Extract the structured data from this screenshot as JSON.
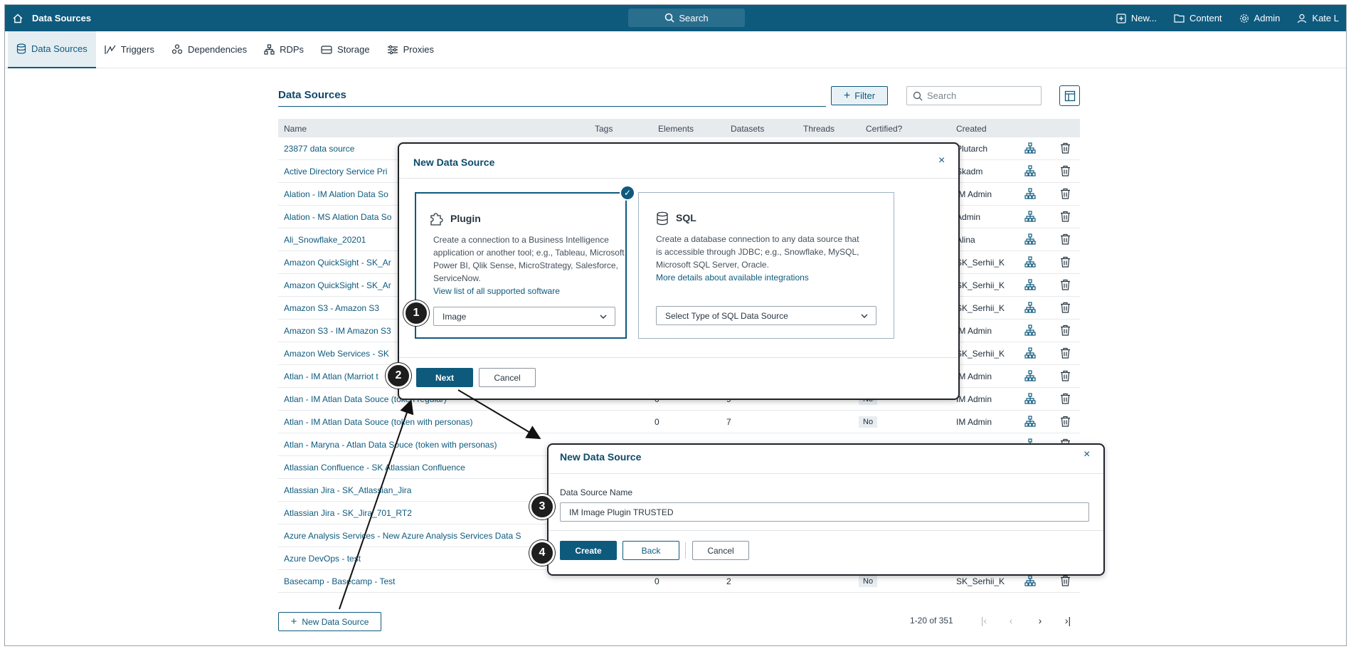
{
  "topbar": {
    "app_title": "Data Sources",
    "search_label": "Search",
    "new_label": "New...",
    "content_label": "Content",
    "admin_label": "Admin",
    "user_label": "Kate L"
  },
  "tabs": [
    {
      "label": "Data Sources",
      "icon": "database-icon"
    },
    {
      "label": "Triggers",
      "icon": "trigger-icon"
    },
    {
      "label": "Dependencies",
      "icon": "dependencies-icon"
    },
    {
      "label": "RDPs",
      "icon": "rdp-icon"
    },
    {
      "label": "Storage",
      "icon": "storage-icon"
    },
    {
      "label": "Proxies",
      "icon": "proxies-icon"
    }
  ],
  "main": {
    "title": "Data Sources",
    "filter_label": "Filter",
    "search_placeholder": "Search",
    "columns": {
      "name": "Name",
      "tags": "Tags",
      "elements": "Elements",
      "datasets": "Datasets",
      "threads": "Threads",
      "certified": "Certified?",
      "created": "Created"
    },
    "rows": [
      {
        "name": "23877 data source",
        "elements": "",
        "datasets": "",
        "certified": "",
        "created": "Plutarch"
      },
      {
        "name": "Active Directory Service Pri",
        "elements": "",
        "datasets": "",
        "certified": "",
        "created": "Skadm"
      },
      {
        "name": "Alation - IM Alation Data So",
        "elements": "",
        "datasets": "",
        "certified": "",
        "created": "IM Admin"
      },
      {
        "name": "Alation - MS Alation Data So",
        "elements": "",
        "datasets": "",
        "certified": "",
        "created": "Admin"
      },
      {
        "name": "Ali_Snowflake_20201",
        "elements": "",
        "datasets": "",
        "certified": "",
        "created": "Alina"
      },
      {
        "name": "Amazon QuickSight - SK_Ar",
        "elements": "",
        "datasets": "",
        "certified": "",
        "created": "SK_Serhii_K"
      },
      {
        "name": "Amazon QuickSight - SK_Ar",
        "elements": "",
        "datasets": "",
        "certified": "",
        "created": "SK_Serhii_K"
      },
      {
        "name": "Amazon S3 - Amazon S3",
        "elements": "",
        "datasets": "",
        "certified": "",
        "created": "SK_Serhii_K"
      },
      {
        "name": "Amazon S3 - IM Amazon S3",
        "elements": "",
        "datasets": "",
        "certified": "",
        "created": "IM Admin"
      },
      {
        "name": "Amazon Web Services - SK",
        "elements": "",
        "datasets": "",
        "certified": "",
        "created": "SK_Serhii_K"
      },
      {
        "name": "Atlan - IM Atlan (Marriot t",
        "elements": "",
        "datasets": "",
        "certified": "",
        "created": "IM Admin"
      },
      {
        "name": "Atlan - IM Atlan Data Souce (token regular)",
        "elements": "0",
        "datasets": "9",
        "certified": "No",
        "created": "IM Admin"
      },
      {
        "name": "Atlan - IM Atlan Data Souce (token with personas)",
        "elements": "0",
        "datasets": "7",
        "certified": "No",
        "created": "IM Admin"
      },
      {
        "name": "Atlan - Maryna - Atlan Data Souce (token with personas)",
        "elements": "",
        "datasets": "",
        "certified": "",
        "created": ""
      },
      {
        "name": "Atlassian Confluence - SK Atlassian Confluence",
        "elements": "",
        "datasets": "",
        "certified": "",
        "created": ""
      },
      {
        "name": "Atlassian Jira - SK_Atlassian_Jira",
        "elements": "",
        "datasets": "",
        "certified": "",
        "created": ""
      },
      {
        "name": "Atlassian Jira - SK_Jira_701_RT2",
        "elements": "",
        "datasets": "",
        "certified": "",
        "created": ""
      },
      {
        "name": "Azure Analysis Services - New Azure Analysis Services Data S",
        "elements": "",
        "datasets": "",
        "certified": "",
        "created": ""
      },
      {
        "name": "Azure DevOps - test",
        "elements": "",
        "datasets": "",
        "certified": "",
        "created": ""
      },
      {
        "name": "Basecamp - Basecamp - Test",
        "elements": "0",
        "datasets": "2",
        "certified": "No",
        "created": "SK_Serhii_K"
      }
    ],
    "new_button": "New Data Source",
    "pager_text": "1-20 of 351"
  },
  "dialog1": {
    "title": "New Data Source",
    "plugin": {
      "title": "Plugin",
      "desc_lines": [
        "Create a connection to a Business Intelligence",
        "application or another tool; e.g., Tableau, Microsoft",
        "Power BI, Qlik Sense, MicroStrategy, Salesforce,",
        "ServiceNow."
      ],
      "link": "View list of all supported software",
      "select_value": "Image"
    },
    "sql": {
      "title": "SQL",
      "desc_lines": [
        "Create a database connection to any data source that",
        "is accessible through JDBC; e.g., Snowflake, MySQL,",
        "Microsoft SQL Server, Oracle."
      ],
      "link": "More details about available integrations",
      "select_placeholder": "Select Type of SQL Data Source"
    },
    "next_label": "Next",
    "cancel_label": "Cancel"
  },
  "dialog2": {
    "title": "New Data Source",
    "field_label": "Data Source Name",
    "field_value": "IM Image Plugin TRUSTED",
    "create_label": "Create",
    "back_label": "Back",
    "cancel_label": "Cancel"
  },
  "steps": [
    "1",
    "2",
    "3",
    "4"
  ],
  "colors": {
    "brand": "#0e5a7d",
    "header_bg": "#0e5a7d",
    "marker": "#1e1e1e"
  }
}
